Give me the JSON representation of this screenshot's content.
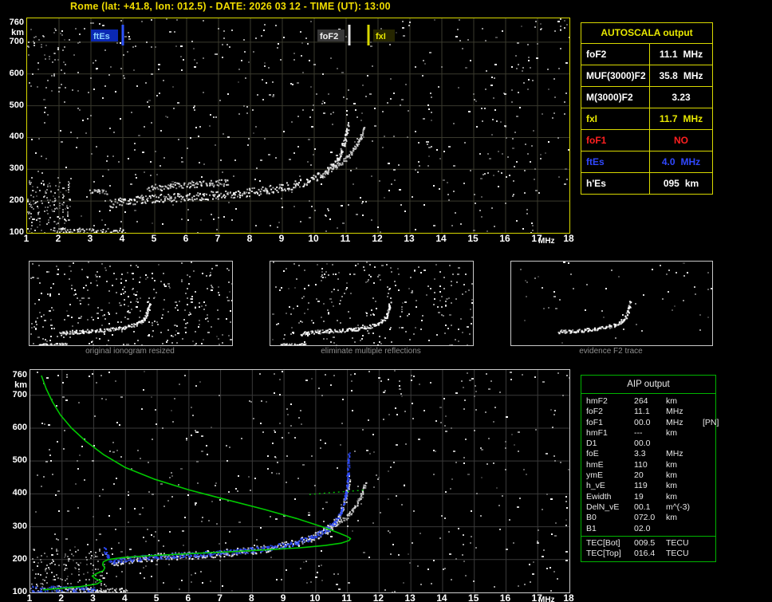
{
  "window": {
    "title": "Rome (lat: +41.8, lon: 012.5) - DATE: 2026 03 12 - TIME (UT): 13:00"
  },
  "palette": {
    "yellow": "#e8e800",
    "white": "#ffffff",
    "red": "#ff2020",
    "blue": "#3048ff",
    "green": "#00c800",
    "caption_gray": "#8f8f8f"
  },
  "top_plot": {
    "y_unit": "km",
    "x_unit": "MHz",
    "y_ticks": [
      760,
      700,
      600,
      500,
      400,
      300,
      200,
      100
    ],
    "x_ticks": [
      "1",
      "2",
      "3",
      "4",
      "5",
      "6",
      "7",
      "8",
      "9",
      "10",
      "11",
      "12",
      "13",
      "14",
      "15",
      "16",
      "17",
      "18"
    ],
    "markers": [
      {
        "label": "ftEs",
        "freq": 4.0,
        "line_color": "#2e54ff",
        "text_color": "#8ad2ff",
        "bg": "#0a28b4",
        "side": "left"
      },
      {
        "label": "foF2",
        "freq": 11.1,
        "line_color": "#e8e8e8",
        "text_color": "#f2f2f2",
        "bg": "#383838",
        "side": "left"
      },
      {
        "label": "fxI",
        "freq": 11.7,
        "line_color": "#d8d800",
        "text_color": "#e8e800",
        "bg": "#262600",
        "side": "right"
      }
    ]
  },
  "bottom_plot": {
    "y_unit": "km",
    "x_unit": "MHz",
    "y_ticks": [
      760,
      700,
      600,
      500,
      400,
      300,
      200,
      100
    ],
    "x_ticks": [
      "1",
      "2",
      "3",
      "4",
      "5",
      "6",
      "7",
      "8",
      "9",
      "10",
      "11",
      "12",
      "13",
      "14",
      "15",
      "16",
      "17",
      "18"
    ]
  },
  "autoscala_table": {
    "header": "AUTOSCALA output",
    "rows": [
      {
        "param": "foF2",
        "value": "11.1",
        "unit": "MHz",
        "color": "#ffffff"
      },
      {
        "param": "MUF(3000)F2",
        "value": "35.8",
        "unit": "MHz",
        "color": "#ffffff"
      },
      {
        "param": "M(3000)F2",
        "value": "3.23",
        "unit": "",
        "color": "#ffffff"
      },
      {
        "param": "fxI",
        "value": "11.7",
        "unit": "MHz",
        "color": "#e8e800"
      },
      {
        "param": "foF1",
        "value": "NO",
        "unit": "",
        "color": "#ff2020"
      },
      {
        "param": "ftEs",
        "value": "4.0",
        "unit": "MHz",
        "color": "#3048ff"
      },
      {
        "param": "h'Es",
        "value": "095",
        "unit": "km",
        "color": "#ffffff"
      }
    ]
  },
  "thumbnails": [
    {
      "caption": "original ionogram resized"
    },
    {
      "caption": "eliminate multiple reflections"
    },
    {
      "caption": "evidence F2 trace"
    }
  ],
  "aip_table": {
    "header": "AIP output",
    "rows": [
      {
        "name": "hmF2",
        "value": "264",
        "unit": "km",
        "extra": ""
      },
      {
        "name": "foF2",
        "value": "11.1",
        "unit": "MHz",
        "extra": ""
      },
      {
        "name": "foF1",
        "value": "00.0",
        "unit": "MHz",
        "extra": "[PN]"
      },
      {
        "name": "hmF1",
        "value": "---",
        "unit": "km",
        "extra": ""
      },
      {
        "name": "D1",
        "value": "00.0",
        "unit": "",
        "extra": ""
      },
      {
        "name": "foE",
        "value": "3.3",
        "unit": "MHz",
        "extra": ""
      },
      {
        "name": "hmE",
        "value": "110",
        "unit": "km",
        "extra": ""
      },
      {
        "name": "ymE",
        "value": "20",
        "unit": "km",
        "extra": ""
      },
      {
        "name": "h_vE",
        "value": "119",
        "unit": "km",
        "extra": ""
      },
      {
        "name": "Ewidth",
        "value": "19",
        "unit": "km",
        "extra": ""
      },
      {
        "name": "DelN_vE",
        "value": "00.1",
        "unit": "m^(-3)",
        "extra": ""
      },
      {
        "name": "B0",
        "value": "072.0",
        "unit": "km",
        "extra": ""
      },
      {
        "name": "B1",
        "value": "02.0",
        "unit": "",
        "extra": ""
      }
    ],
    "tec_rows": [
      {
        "name": "TEC[Bot]",
        "value": "009.5",
        "unit": "TECU",
        "extra": ""
      },
      {
        "name": "TEC[Top]",
        "value": "016.4",
        "unit": "TECU",
        "extra": ""
      }
    ]
  },
  "chart_data": {
    "type": "scatter",
    "x_unit": "MHz",
    "y_unit": "km",
    "x_range": [
      1,
      18
    ],
    "y_range": [
      100,
      760
    ],
    "f2_trace": [
      [
        3.6,
        190
      ],
      [
        3.9,
        196
      ],
      [
        4.2,
        200
      ],
      [
        4.6,
        204
      ],
      [
        5.0,
        207
      ],
      [
        5.5,
        210
      ],
      [
        6.0,
        212
      ],
      [
        6.5,
        215
      ],
      [
        7.0,
        218
      ],
      [
        7.5,
        222
      ],
      [
        8.0,
        227
      ],
      [
        8.5,
        233
      ],
      [
        9.0,
        241
      ],
      [
        9.4,
        250
      ],
      [
        9.8,
        262
      ],
      [
        10.1,
        275
      ],
      [
        10.4,
        292
      ],
      [
        10.6,
        310
      ],
      [
        10.75,
        330
      ],
      [
        10.85,
        355
      ],
      [
        10.95,
        385
      ],
      [
        11.02,
        415
      ],
      [
        11.06,
        440
      ]
    ],
    "f2_upper": [
      [
        4.8,
        240
      ],
      [
        5.5,
        247
      ],
      [
        6.2,
        252
      ],
      [
        6.8,
        255
      ],
      [
        7.3,
        257
      ]
    ],
    "f2_x_branch": [
      [
        10.3,
        290
      ],
      [
        10.7,
        308
      ],
      [
        11.0,
        330
      ],
      [
        11.25,
        360
      ],
      [
        11.45,
        395
      ],
      [
        11.58,
        430
      ]
    ],
    "f1_tail": [
      [
        3.0,
        228
      ],
      [
        3.25,
        231
      ],
      [
        3.5,
        226
      ]
    ],
    "es_trace": [
      [
        1.9,
        104
      ],
      [
        4.05,
        104
      ]
    ],
    "electron_density_profile": [
      [
        1.35,
        760
      ],
      [
        1.5,
        720
      ],
      [
        1.7,
        680
      ],
      [
        1.95,
        640
      ],
      [
        2.3,
        600
      ],
      [
        2.75,
        560
      ],
      [
        3.3,
        520
      ],
      [
        4.0,
        480
      ],
      [
        4.9,
        445
      ],
      [
        6.0,
        412
      ],
      [
        7.2,
        382
      ],
      [
        8.4,
        352
      ],
      [
        9.4,
        325
      ],
      [
        10.2,
        300
      ],
      [
        10.7,
        282
      ],
      [
        11.0,
        270
      ],
      [
        11.1,
        264
      ],
      [
        11.05,
        258
      ],
      [
        10.8,
        250
      ],
      [
        10.3,
        243
      ],
      [
        9.5,
        236
      ],
      [
        8.5,
        230
      ],
      [
        7.3,
        224
      ],
      [
        6.0,
        218
      ],
      [
        4.8,
        212
      ],
      [
        3.9,
        206
      ],
      [
        3.45,
        200
      ],
      [
        3.3,
        193
      ],
      [
        3.28,
        184
      ],
      [
        3.35,
        175
      ],
      [
        3.3,
        166
      ],
      [
        3.1,
        158
      ],
      [
        2.95,
        150
      ],
      [
        3.05,
        142
      ],
      [
        3.25,
        134
      ],
      [
        3.1,
        126
      ],
      [
        2.6,
        118
      ],
      [
        1.9,
        112
      ],
      [
        1.4,
        108
      ]
    ],
    "profile_extension_dotted": [
      [
        9.8,
        398
      ],
      [
        10.5,
        404
      ],
      [
        11.1,
        408
      ],
      [
        11.55,
        412
      ]
    ],
    "restored_trace": [
      [
        3.35,
        230
      ],
      [
        3.42,
        214
      ],
      [
        3.5,
        200
      ],
      [
        3.65,
        192
      ],
      [
        3.9,
        197
      ],
      [
        4.2,
        201
      ],
      [
        4.6,
        205
      ],
      [
        5.0,
        208
      ],
      [
        5.5,
        211
      ],
      [
        6.0,
        213
      ],
      [
        6.5,
        216
      ],
      [
        7.0,
        219
      ],
      [
        7.5,
        223
      ],
      [
        8.0,
        228
      ],
      [
        8.5,
        234
      ],
      [
        9.0,
        242
      ],
      [
        9.4,
        251
      ],
      [
        9.8,
        263
      ],
      [
        10.1,
        276
      ],
      [
        10.4,
        293
      ],
      [
        10.6,
        311
      ],
      [
        10.75,
        331
      ],
      [
        10.85,
        356
      ],
      [
        10.95,
        386
      ],
      [
        11.0,
        420
      ],
      [
        11.03,
        460
      ],
      [
        11.05,
        500
      ],
      [
        11.06,
        520
      ]
    ],
    "e_region_blue": [
      [
        1.0,
        108
      ],
      [
        3.05,
        108
      ]
    ]
  }
}
